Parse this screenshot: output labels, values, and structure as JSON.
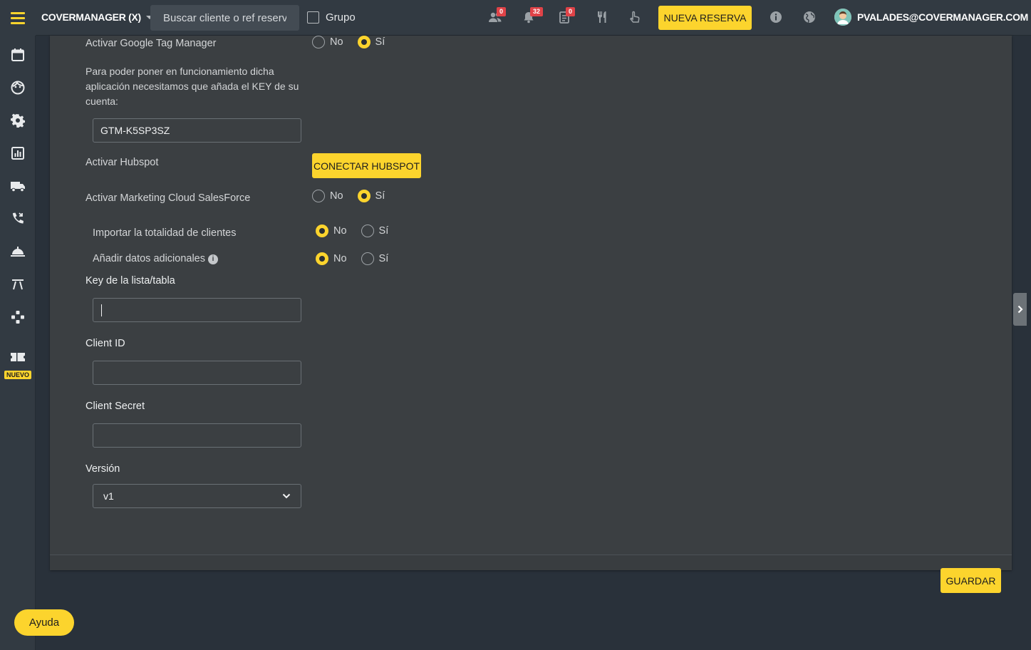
{
  "header": {
    "brand": "COVERMANAGER (X)",
    "search_placeholder": "Buscar cliente o ref reserva",
    "grupo_label": "Grupo",
    "badges": {
      "people": "0",
      "bell": "32",
      "notes": "0"
    },
    "nueva_reserva_label": "NUEVA RESERVA",
    "user_email": "PVALADES@COVERMANAGER.COM",
    "icons": [
      "people-icon",
      "bell-icon",
      "notes-icon",
      "utensils-icon",
      "hand-pointer-icon",
      "info-icon",
      "globe-icon"
    ]
  },
  "sidebar": {
    "items": [
      "calendar-icon",
      "face-icon",
      "settings-icon",
      "chart-icon",
      "truck-icon",
      "phone-icon",
      "service-bell-icon",
      "road-icon",
      "gamepad-icon",
      "ticket-icon"
    ],
    "nuevo_label": "NUEVO"
  },
  "form": {
    "gtm_label": "Activar Google Tag Manager",
    "gtm_description": "Para poder poner en funcionamiento dicha aplicación necesitamos que añada el KEY de su cuenta:",
    "gtm_key_value": "GTM-K5SP3SZ",
    "hubspot_label": "Activar Hubspot",
    "hubspot_button": "CONECTAR HUBSPOT",
    "salesforce_label": "Activar Marketing Cloud SalesForce",
    "importar_label": "Importar la totalidad de clientes",
    "datos_label": "Añadir datos adicionales",
    "option_no": "No",
    "option_si": "Sí",
    "key_lista_label": "Key de la lista/tabla",
    "key_lista_value": "",
    "client_id_label": "Client ID",
    "client_id_value": "",
    "client_secret_label": "Client Secret",
    "client_secret_value": "",
    "version_label": "Versión",
    "version_value": "v1",
    "selected": {
      "gtm": "si",
      "salesforce": "si",
      "importar": "no",
      "datos": "no"
    }
  },
  "footer": {
    "guardar_label": "GUARDAR",
    "ayuda_label": "Ayuda"
  },
  "colors": {
    "accent": "#fcd42d",
    "badge": "#e04348",
    "panel": "#3b3f42",
    "background": "#29313a"
  }
}
